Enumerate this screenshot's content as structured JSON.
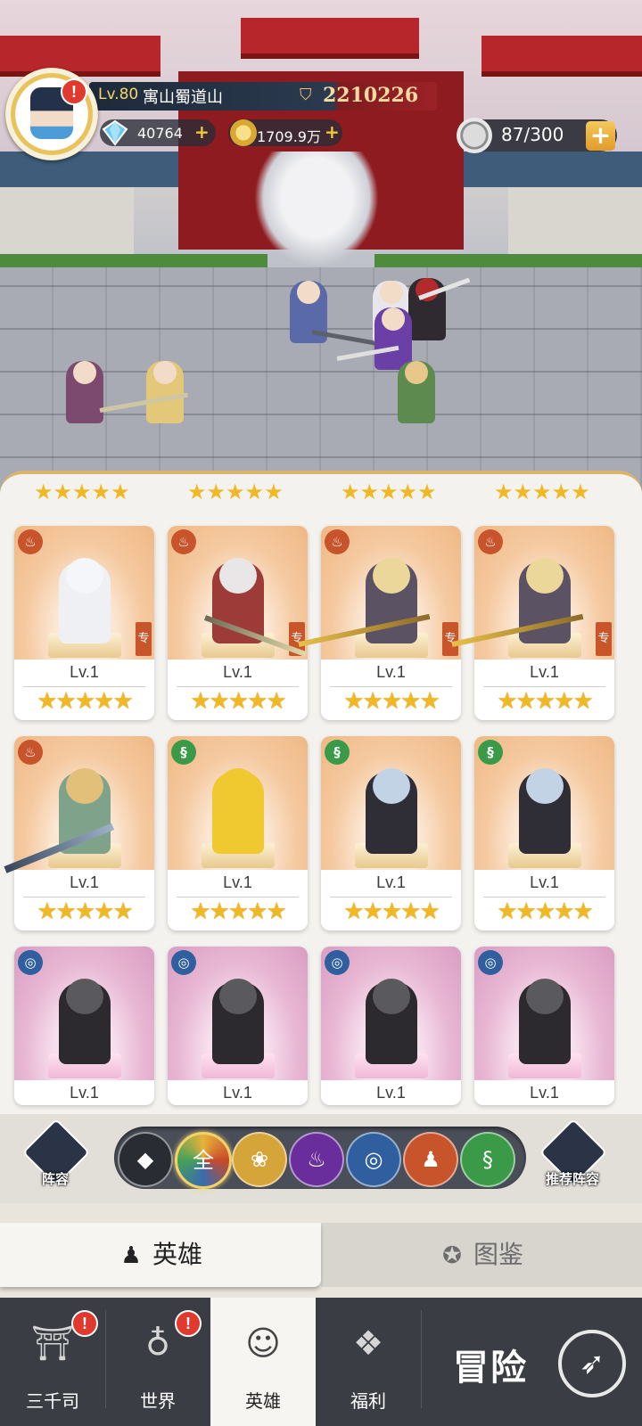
{
  "player": {
    "level": "Lv.80",
    "name": "寓山蜀道山",
    "power": "2210226"
  },
  "resources": {
    "gems": "40764",
    "gold": "1709.9万",
    "stamina": "87/300"
  },
  "hero_cards": [
    {
      "level": "Lv.1",
      "stars": "★★★★★",
      "element": "fire",
      "tag": "专"
    },
    {
      "level": "Lv.1",
      "stars": "★★★★★",
      "element": "fire",
      "tag": "专"
    },
    {
      "level": "Lv.1",
      "stars": "★★★★★",
      "element": "fire",
      "tag": "专"
    },
    {
      "level": "Lv.1",
      "stars": "★★★★★",
      "element": "fire",
      "tag": "专"
    },
    {
      "level": "Lv.1",
      "stars": "★★★★★",
      "element": "fire",
      "tag": ""
    },
    {
      "level": "Lv.1",
      "stars": "★★★★★",
      "element": "poison",
      "tag": ""
    },
    {
      "level": "Lv.1",
      "stars": "★★★★★",
      "element": "poison",
      "tag": ""
    },
    {
      "level": "Lv.1",
      "stars": "★★★★★",
      "element": "poison",
      "tag": ""
    },
    {
      "level": "Lv.1",
      "stars": "",
      "element": "water",
      "tag": ""
    },
    {
      "level": "Lv.1",
      "stars": "",
      "element": "water",
      "tag": ""
    },
    {
      "level": "Lv.1",
      "stars": "",
      "element": "water",
      "tag": ""
    },
    {
      "level": "Lv.1",
      "stars": "",
      "element": "water",
      "tag": ""
    }
  ],
  "top_partial_stars": [
    "★★★★★",
    "★★★★★",
    "★★★★★",
    "★★★★★"
  ],
  "filter": {
    "lineup_label": "阵容",
    "recommend_label": "推荐阵容",
    "all_label": "全",
    "options": [
      "gold-diamond-icon",
      "all",
      "lotus-icon",
      "flame-icon",
      "water-swirl-icon",
      "meditation-icon",
      "dna-icon"
    ]
  },
  "subtabs": {
    "heroes": "英雄",
    "codex": "图鉴"
  },
  "nav": {
    "items": [
      "三千司",
      "世界",
      "英雄",
      "福利"
    ],
    "adventure": "冒险"
  },
  "alert_mark": "!"
}
